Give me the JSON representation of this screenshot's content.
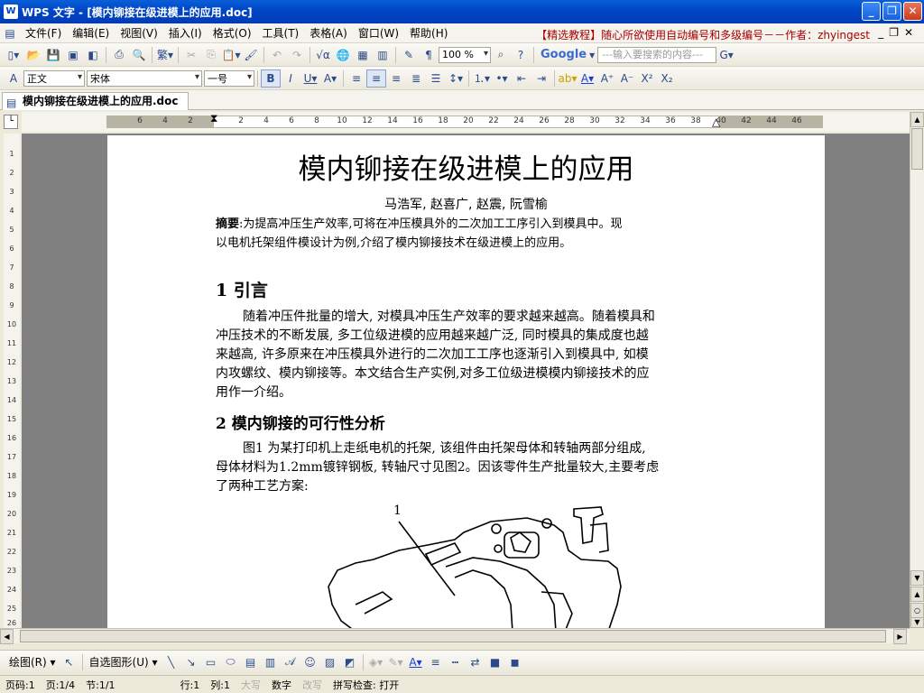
{
  "window": {
    "title": "WPS 文字 - [模内铆接在级进模上的应用.doc]"
  },
  "menu": {
    "items": [
      "文件(F)",
      "编辑(E)",
      "视图(V)",
      "插入(I)",
      "格式(O)",
      "工具(T)",
      "表格(A)",
      "窗口(W)",
      "帮助(H)"
    ],
    "promo": "【精选教程】随心所欲使用自动编号和多级编号－－作者：zhyingest"
  },
  "toolbar1": {
    "zoom": "100 %",
    "search_placeholder": "---输入要搜索的内容---",
    "google": "Google"
  },
  "toolbar2": {
    "style": "正文",
    "font": "宋体",
    "size": "一号"
  },
  "tab": {
    "label": "模内铆接在级进模上的应用.doc"
  },
  "ruler": {
    "h_ticks": [
      "6",
      "4",
      "2",
      "2",
      "4",
      "6",
      "8",
      "10",
      "12",
      "14",
      "16",
      "18",
      "20",
      "22",
      "24",
      "26",
      "28",
      "30",
      "32",
      "34",
      "36",
      "38",
      "40",
      "42",
      "44",
      "46"
    ],
    "v_ticks": [
      "1",
      "2",
      "3",
      "4",
      "5",
      "6",
      "7",
      "8",
      "9",
      "10",
      "11",
      "12",
      "13",
      "14",
      "15",
      "16",
      "17",
      "18",
      "19",
      "20",
      "21",
      "22",
      "23",
      "24",
      "25",
      "26"
    ]
  },
  "document": {
    "title": "模内铆接在级进模上的应用",
    "authors": "马浩军, 赵喜广, 赵震, 阮雪榆",
    "abstract_label": "摘要",
    "abstract_line1": ":为提高冲压生产效率,可将在冲压模具外的二次加工工序引入到模具中。现",
    "abstract_line2": "以电机托架组件模设计为例,介绍了模内铆接技术在级进模上的应用。",
    "section1_title": "1  引言",
    "section1_lines": [
      "随着冲压件批量的增大, 对模具冲压生产效率的要求越来越高。随着模具和",
      "冲压技术的不断发展, 多工位级进模的应用越来越广泛, 同时模具的集成度也越",
      "来越高, 许多原来在冲压模具外进行的二次加工工序也逐渐引入到模具中, 如模",
      "内攻螺纹、模内铆接等。本文结合生产实例,对多工位级进模模内铆接技术的应",
      "用作一介绍。"
    ],
    "section2_title": "2  模内铆接的可行性分析",
    "section2_lines": [
      "图1 为某打印机上走纸电机的托架, 该组件由托架母体和转轴两部分组成,",
      "母体材料为1.2mm镀锌钢板, 转轴尺寸见图2。因该零件生产批量较大,主要考虑",
      "了两种工艺方案:"
    ],
    "figure_label": "1"
  },
  "drawbar": {
    "draw": "绘图(R)",
    "autoshape": "自选图形(U)"
  },
  "status": {
    "page": "页码:1",
    "pages": "页:1/4",
    "section": "节:1/1",
    "row": "行:1",
    "col": "列:1",
    "caps": "大写",
    "num": "数字",
    "ovr": "改写",
    "spell": "拼写检查: 打开"
  }
}
